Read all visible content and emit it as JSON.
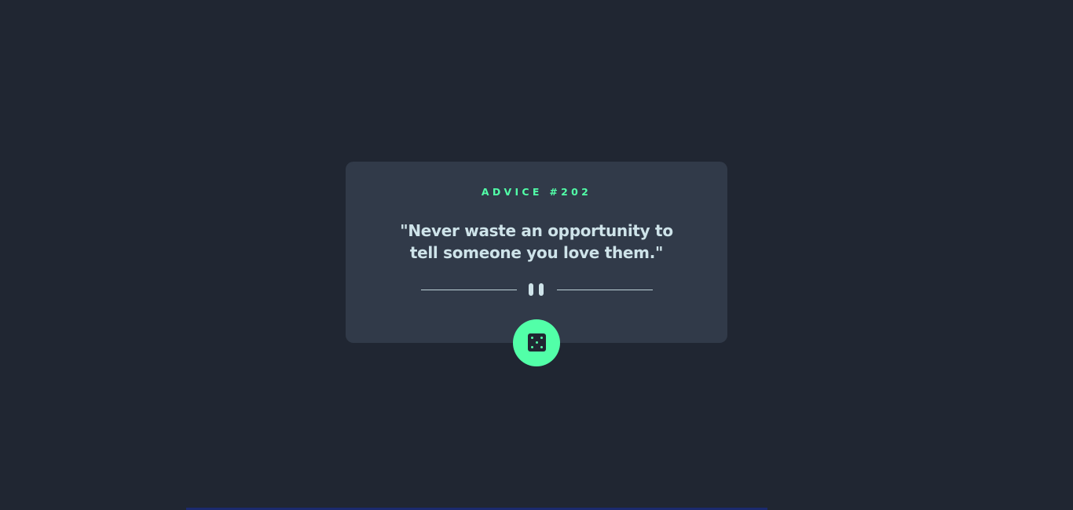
{
  "card": {
    "title": "ADVICE #202",
    "quote": "\"Never waste an opportunity to tell someone you love them.\""
  },
  "icons": {
    "divider": "pause-icon",
    "button": "dice-icon"
  },
  "colors": {
    "background": "#202632",
    "card": "#313a49",
    "accent": "#52ffa8",
    "text": "#cee3e9"
  }
}
